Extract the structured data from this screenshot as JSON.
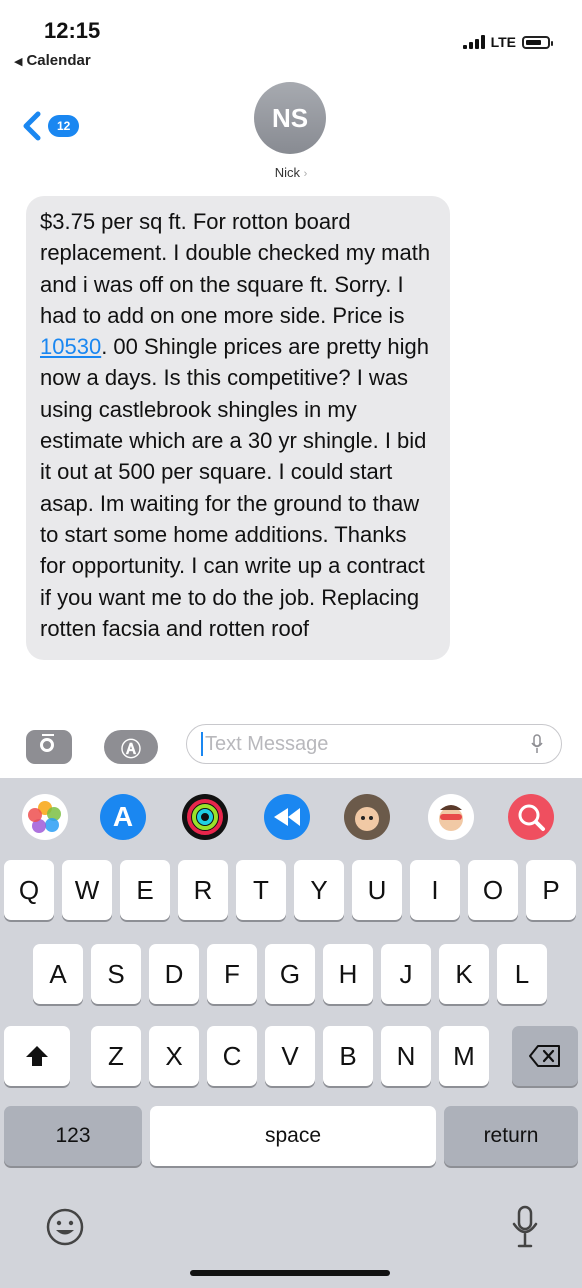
{
  "status_bar": {
    "time": "12:15",
    "back_app": "Calendar",
    "network": "LTE"
  },
  "header": {
    "back_badge": "12",
    "avatar_initials": "NS",
    "contact_name": "Nick"
  },
  "message": {
    "text_before_link": "$3.75 per sq ft. For rotton board replacement.   I double checked my math and i was off on the square ft. Sorry. I had to add on one more side. Price is ",
    "link_text": "10530",
    "text_after_link": ". 00 Shingle prices are pretty high now a days. Is this competitive? I was using castlebrook shingles in my estimate which are a 30 yr shingle. I bid it out at 500 per square. I could start asap. Im waiting for the ground to thaw to start some home additions. Thanks for opportunity. I can write up a contract if you want me to do the job. Replacing rotten facsia and rotten roof"
  },
  "input": {
    "placeholder": "Text Message"
  },
  "keyboard": {
    "row1": [
      "Q",
      "W",
      "E",
      "R",
      "T",
      "Y",
      "U",
      "I",
      "O",
      "P"
    ],
    "row2": [
      "A",
      "S",
      "D",
      "F",
      "G",
      "H",
      "J",
      "K",
      "L"
    ],
    "row3": [
      "Z",
      "X",
      "C",
      "V",
      "B",
      "N",
      "M"
    ],
    "numbers_key": "123",
    "space_key": "space",
    "return_key": "return"
  },
  "app_drawer": [
    "photos-icon",
    "app-store-icon",
    "activity-icon",
    "memoji-sticker-icon",
    "memoji-girl-icon",
    "memoji-boy-icon",
    "images-search-icon"
  ],
  "colors": {
    "accent": "#1a87f1",
    "bubble": "#e9e9eb",
    "keyboard": "#d2d4da"
  }
}
